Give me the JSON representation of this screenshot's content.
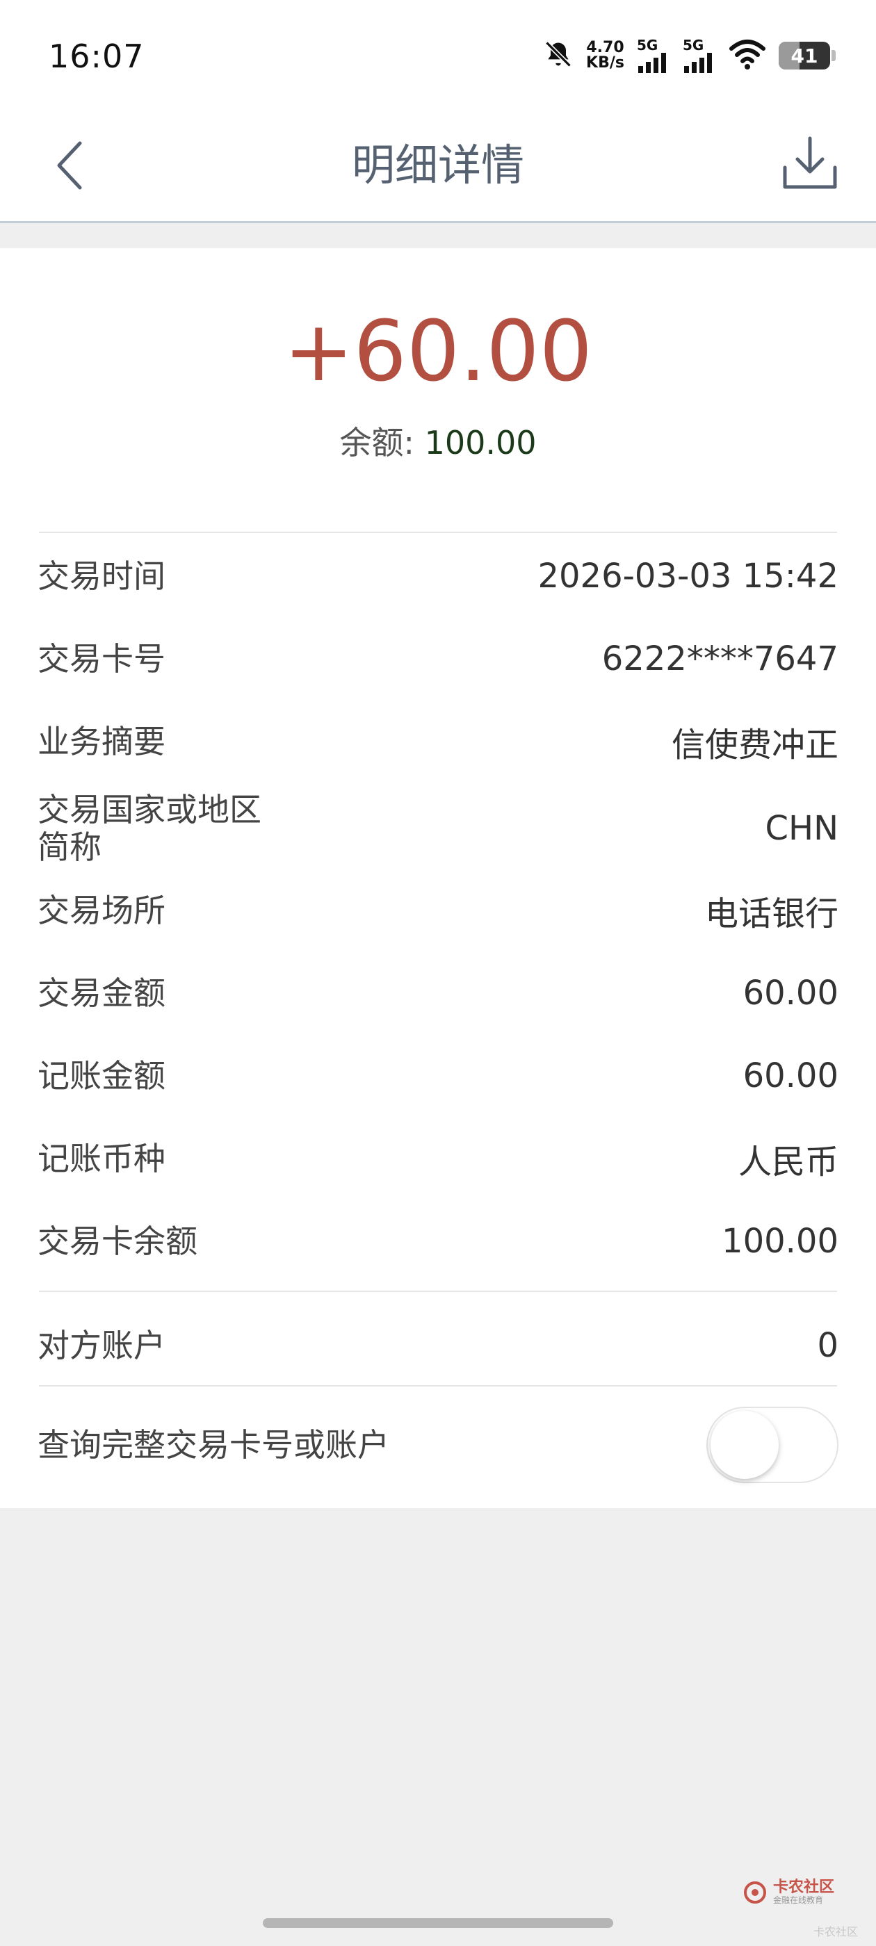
{
  "status_bar": {
    "time": "16:07",
    "net_speed_value": "4.70",
    "net_speed_unit": "KB/s",
    "sim1_label": "5G",
    "sim2_label": "5G",
    "battery_level": "41",
    "battery_fraction": 0.41
  },
  "nav": {
    "title": "明细详情"
  },
  "summary": {
    "amount": "+60.00",
    "balance_label": "余额:",
    "balance_value": "100.00",
    "amount_color": "#b24f41"
  },
  "details": [
    {
      "label": "交易时间",
      "value": "2026-03-03 15:42"
    },
    {
      "label": "交易卡号",
      "value": "6222****7647"
    },
    {
      "label": "业务摘要",
      "value": "信使费冲正"
    },
    {
      "label": "交易国家或地区简称",
      "value": "CHN"
    },
    {
      "label": "交易场所",
      "value": "电话银行"
    },
    {
      "label": "交易金额",
      "value": "60.00"
    },
    {
      "label": "记账金额",
      "value": "60.00"
    },
    {
      "label": "记账币种",
      "value": "人民币"
    },
    {
      "label": "交易卡余额",
      "value": "100.00"
    }
  ],
  "counterparty": {
    "label": "对方账户",
    "value": "0"
  },
  "full_number_toggle": {
    "label": "查询完整交易卡号或账户",
    "enabled": false
  },
  "watermark": {
    "main": "卡农社区",
    "sub": "金融在线教育",
    "corner": "卡农社区"
  }
}
